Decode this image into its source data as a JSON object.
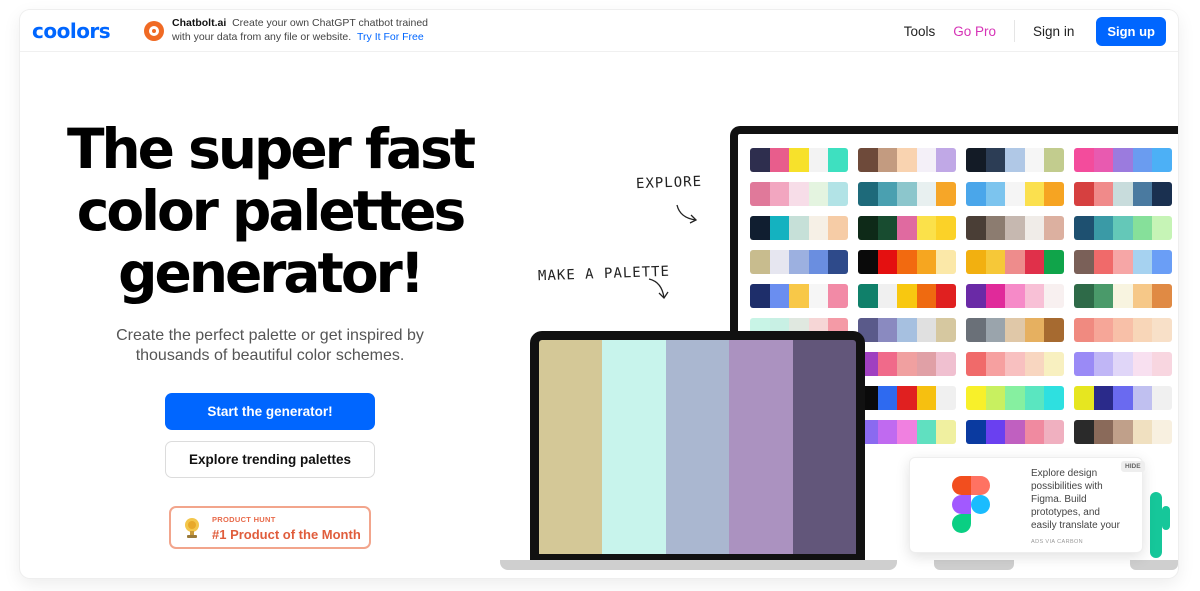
{
  "nav": {
    "logo": "coolors",
    "ad_brand": "Chatbolt.ai",
    "ad_text": "Create your own ChatGPT chatbot trained with your data from any file or website.",
    "ad_link": "Try It For Free",
    "tools": "Tools",
    "go_pro": "Go Pro",
    "sign_in": "Sign in",
    "sign_up": "Sign up"
  },
  "hero": {
    "title": "The super fast color palettes generator!",
    "subtitle": "Create the perfect palette or get inspired by thousands of beautiful color schemes.",
    "primary_button": "Start the generator!",
    "secondary_button": "Explore trending palettes",
    "badge_small": "PRODUCT HUNT",
    "badge_big": "#1 Product of the Month"
  },
  "annotations": {
    "explore": "EXPLORE",
    "make_palette": "MAKE A PALETTE"
  },
  "carbon_ad": {
    "text": "Explore design possibilities with Figma. Build prototypes, and easily translate your work into",
    "via": "ADS VIA CARBON",
    "hide": "HIDE"
  },
  "colors": {
    "accent": "#0066ff",
    "go_pro": "#d633b6",
    "badge": "#e05d3c"
  },
  "laptop_palette": [
    "#d4c897",
    "#c8f4ec",
    "#aab7d0",
    "#ab92c0",
    "#62567a"
  ],
  "palettes": [
    [
      "#2e2e4e",
      "#e85d8c",
      "#f7e12b",
      "#f3f3f3",
      "#3ee0c0"
    ],
    [
      "#6e4a3a",
      "#c39b80",
      "#f9d3b0",
      "#f4f0f8",
      "#c0a8e6"
    ],
    [
      "#131b26",
      "#2c3d55",
      "#b0c8e6",
      "#f6f6f6",
      "#c2cc8e"
    ],
    [
      "#f34c9c",
      "#e85ab0",
      "#9b7bde",
      "#6a9cf0",
      "#4cb0f6"
    ],
    [
      "#e0799a",
      "#f2a6c0",
      "#f7dde8",
      "#e4f4e0",
      "#b2e3e6"
    ],
    [
      "#1e6a7a",
      "#4aa0b0",
      "#8cc6cc",
      "#e8f0f0",
      "#f6a628"
    ],
    [
      "#4aa6ea",
      "#7cc4ee",
      "#f5f5f5",
      "#fbe04e",
      "#f6a422"
    ],
    [
      "#d64040",
      "#f08a8a",
      "#c8dcdc",
      "#4a7aa0",
      "#1a3050"
    ],
    [
      "#101e30",
      "#14b2c0",
      "#c6e0d8",
      "#f6f0e6",
      "#f6cca6"
    ],
    [
      "#0e2a18",
      "#184c30",
      "#e06aa0",
      "#fbe14a",
      "#fbd228"
    ],
    [
      "#4a3e36",
      "#8c7c70",
      "#c6b8b0",
      "#f0ece8",
      "#dcb0a0"
    ],
    [
      "#1e5070",
      "#3a9aa6",
      "#64c8b8",
      "#86e09a",
      "#c6f4b6"
    ],
    [
      "#c8bc8e",
      "#e6e6f0",
      "#9cb0e0",
      "#6a8ee0",
      "#2e4a8a"
    ],
    [
      "#0a0a0a",
      "#e41010",
      "#f26a10",
      "#f6a620",
      "#fbe8a8"
    ],
    [
      "#f2b010",
      "#f6c838",
      "#ee8c8c",
      "#e0304a",
      "#10a44a"
    ],
    [
      "#7a6058",
      "#f06a6a",
      "#f6a6a6",
      "#a6d2f0",
      "#6a9ef6"
    ],
    [
      "#1e2e6a",
      "#6a8ef0",
      "#f8c848",
      "#f6f6f6",
      "#f28aa6"
    ],
    [
      "#10806a",
      "#f0f0f0",
      "#f8c810",
      "#ef6a10",
      "#e02020"
    ],
    [
      "#6a2aa6",
      "#e02a9a",
      "#f68ac8",
      "#f8c0d6",
      "#f8f0f0"
    ],
    [
      "#2e6a48",
      "#4a9a6a",
      "#f8f4e0",
      "#f6c888",
      "#e08a44"
    ],
    [
      "#c8f4e6",
      "#c8f0e4",
      "#e0e8e0",
      "#f6d6d6",
      "#f49aa6"
    ],
    [
      "#5a5a8a",
      "#8a8ac0",
      "#a6c0e0",
      "#e0e0e0",
      "#d6c8a0"
    ],
    [
      "#6a7078",
      "#9aa4ac",
      "#e0c8a8",
      "#e6b060",
      "#a66a30"
    ],
    [
      "#f08a80",
      "#f6a698",
      "#f8c0a8",
      "#f8d6b8",
      "#f8e0c8"
    ],
    [
      "#2e6a8a",
      "#f06a6a",
      "#f6a0a6",
      "#c0d6e6",
      "#a0f0f0"
    ],
    [
      "#a040c0",
      "#f06a8a",
      "#f0a0a0",
      "#e0a0a6",
      "#f0c0d0"
    ],
    [
      "#f06a6a",
      "#f6a0a0",
      "#f8c0c0",
      "#f8d6c0",
      "#f8f0c0"
    ],
    [
      "#9a8af6",
      "#c0b6f6",
      "#e0d6f8",
      "#f8e0f0",
      "#f8d6e0"
    ],
    [
      "#1e2a4a",
      "#f6a020",
      "#f8c040",
      "#5a8a2a",
      "#2e5a1a"
    ],
    [
      "#0a0a0a",
      "#2e6af0",
      "#e02020",
      "#f6c010",
      "#f0f0f0"
    ],
    [
      "#f8f02a",
      "#c8f060",
      "#86f0a0",
      "#5ae6c0",
      "#2ee0e0"
    ],
    [
      "#e6e620",
      "#2a2a8a",
      "#6a6af0",
      "#c0c0f0",
      "#f0f0f0"
    ],
    [
      "#2020a0",
      "#2a6af0",
      "#f8e020",
      "#f8c010",
      "#f8a010"
    ],
    [
      "#8a6af0",
      "#c06af0",
      "#f080e0",
      "#60e0c0",
      "#f0f0a0"
    ],
    [
      "#0a3aa0",
      "#6a40f0",
      "#c060c0",
      "#f08aa0",
      "#f0b0c0"
    ],
    [
      "#2a2a2a",
      "#8a6a5a",
      "#c0a08a",
      "#f0e0c0",
      "#f8f0e0"
    ],
    [
      "#4ad6e6",
      "#2a6af0",
      "#f06a8a",
      "#f8a0c0",
      "#2aa6f0"
    ]
  ]
}
